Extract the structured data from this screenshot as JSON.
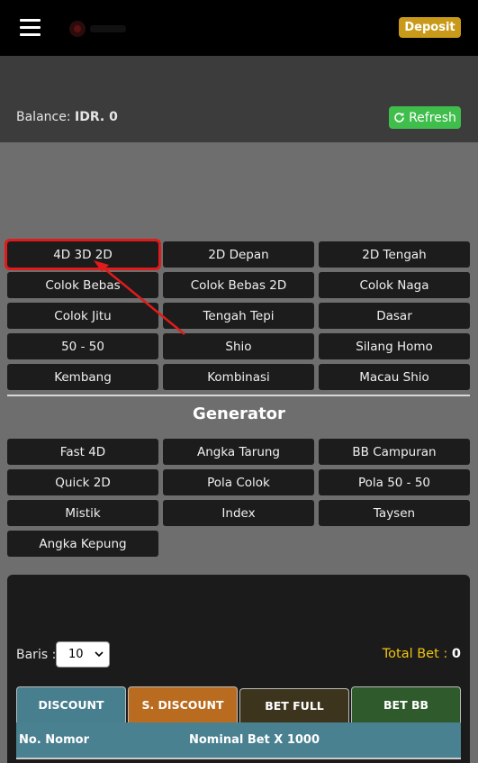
{
  "header": {
    "deposit_label": "Deposit"
  },
  "balance": {
    "label": "Balance:",
    "value": "IDR. 0",
    "refresh_label": "Refresh"
  },
  "games": [
    "4D 3D 2D",
    "2D Depan",
    "2D Tengah",
    "Colok Bebas",
    "Colok Bebas 2D",
    "Colok Naga",
    "Colok Jitu",
    "Tengah Tepi",
    "Dasar",
    "50 - 50",
    "Shio",
    "Silang Homo",
    "Kembang",
    "Kombinasi",
    "Macau Shio"
  ],
  "generator": {
    "title": "Generator",
    "items": [
      "Fast 4D",
      "Angka Tarung",
      "BB Campuran",
      "Quick 2D",
      "Pola Colok",
      "Pola 50 - 50",
      "Mistik",
      "Index",
      "Taysen",
      "Angka Kepung"
    ]
  },
  "bet_panel": {
    "baris_label": "Baris :",
    "baris_value": "10",
    "total_bet_label": "Total Bet :",
    "total_bet_value": "0",
    "tabs": [
      "DISCOUNT",
      "S. DISCOUNT",
      "BET FULL",
      "BET BB"
    ],
    "columns": [
      "No.",
      "Nomor",
      "Nominal Bet X 1000"
    ]
  },
  "colors": {
    "deposit": "#c99a1a",
    "refresh": "#3fbe4c",
    "highlight": "#e01b1b",
    "total_bet": "#f1c40f"
  }
}
